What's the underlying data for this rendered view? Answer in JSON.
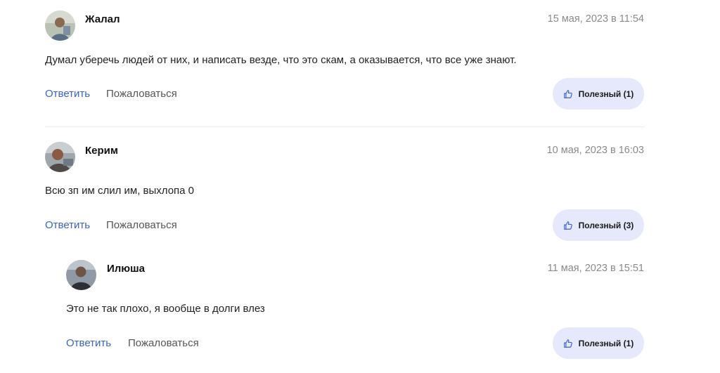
{
  "comments": [
    {
      "author": "Жалал",
      "date": "15 мая, 2023 в 11:54",
      "text": "Думал уберечь людей от них, и написать везде, что это скам, а оказывается, что все уже знают.",
      "reply_label": "Ответить",
      "report_label": "Пожаловаться",
      "useful_label": "Полезный (1)"
    },
    {
      "author": "Керим",
      "date": "10 мая, 2023 в 16:03",
      "text": "Всю зп им слил им, выхлопа 0",
      "reply_label": "Ответить",
      "report_label": "Пожаловаться",
      "useful_label": "Полезный (3)"
    },
    {
      "author": "Илюша",
      "date": "11 мая, 2023 в 15:51",
      "text": "Это не так плохо, я вообще в долги влез",
      "reply_label": "Ответить",
      "report_label": "Пожаловаться",
      "useful_label": "Полезный (1)"
    }
  ],
  "colors": {
    "accent": "#3a63c7",
    "useful_bg": "#e5e9fb",
    "date": "#8a8a8a"
  },
  "icons": {
    "useful": "thumbs-up-icon"
  }
}
